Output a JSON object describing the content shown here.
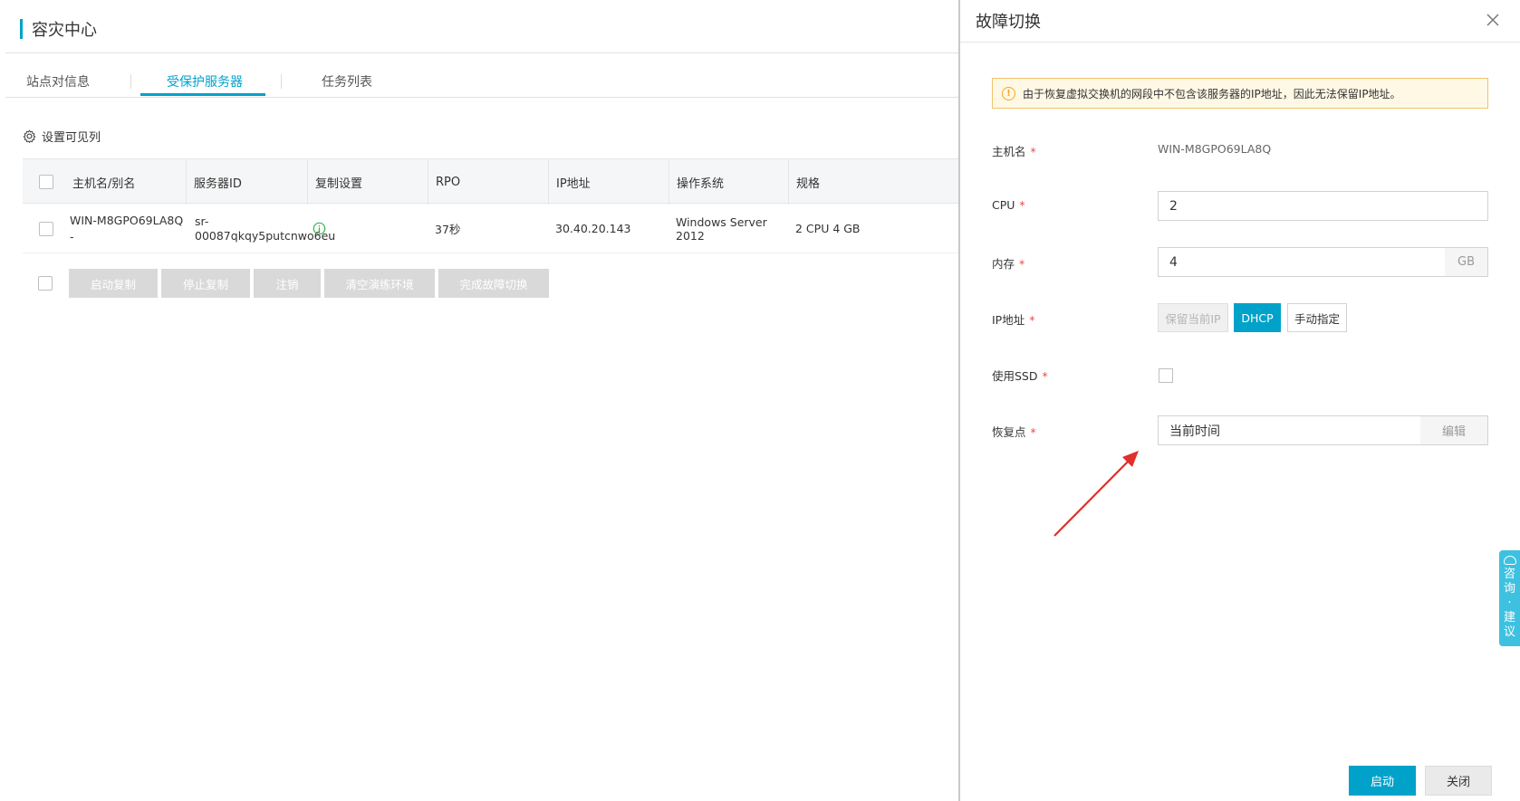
{
  "page": {
    "title": "容灾中心",
    "tabs": [
      {
        "label": "站点对信息",
        "active": false
      },
      {
        "label": "受保护服务器",
        "active": true
      },
      {
        "label": "任务列表",
        "active": false
      }
    ],
    "column_settings_label": "设置可见列"
  },
  "table": {
    "headers": [
      "主机名/别名",
      "服务器ID",
      "复制设置",
      "RPO",
      "IP地址",
      "操作系统",
      "规格"
    ],
    "rows": [
      {
        "hostname": "WIN-M8GPO69LA8Q",
        "alias": "-",
        "server_id_line1": "sr-",
        "server_id_line2": "00087qkqy5putcnwo6eu",
        "rpo": "37秒",
        "ip": "30.40.20.143",
        "os": "Windows Server 2012",
        "spec": "2 CPU 4 GB"
      }
    ]
  },
  "actions": {
    "start_replication": "启动复制",
    "stop_replication": "停止复制",
    "deregister": "注销",
    "clear_drill": "清空演练环境",
    "complete_failover": "完成故障切换"
  },
  "drawer": {
    "title": "故障切换",
    "alert": "由于恢复虚拟交换机的网段中不包含该服务器的IP地址，因此无法保留IP地址。",
    "fields": {
      "hostname_label": "主机名",
      "hostname_value": "WIN-M8GPO69LA8Q",
      "cpu_label": "CPU",
      "cpu_value": "2",
      "memory_label": "内存",
      "memory_value": "4",
      "memory_unit": "GB",
      "ip_label": "IP地址",
      "ip_options": {
        "keep": "保留当前IP",
        "dhcp": "DHCP",
        "manual": "手动指定"
      },
      "ip_selected": "DHCP",
      "ssd_label": "使用SSD",
      "ssd_checked": false,
      "restore_label": "恢复点",
      "restore_value": "当前时间",
      "restore_edit": "编辑"
    },
    "required_mark": "*",
    "start_button": "启动",
    "close_button": "关闭"
  },
  "consult_tab": {
    "chars": [
      "咨",
      "询",
      "·",
      "建",
      "议"
    ]
  },
  "colors": {
    "accent": "#00a2ca",
    "required": "#e94b3c",
    "alert_bg": "#fff8e5",
    "alert_border": "#f0c36d",
    "arrow": "#e0302a"
  }
}
